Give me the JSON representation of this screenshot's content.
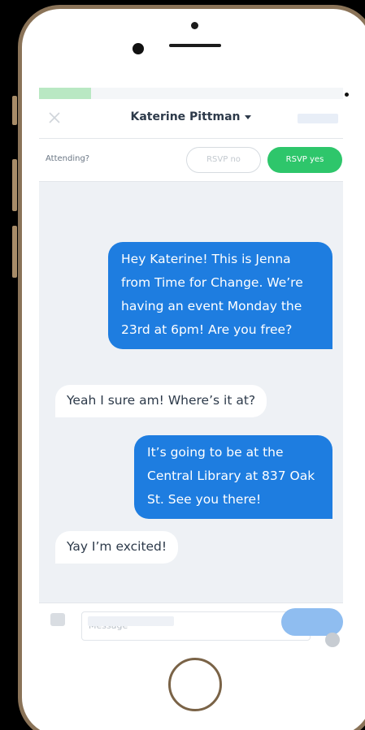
{
  "header": {
    "contact_name": "Katerine Pittman"
  },
  "progress": {
    "fraction": 0.17,
    "color": "#b9e8c3"
  },
  "rsvp": {
    "question": "Attending?",
    "no_label": "RSVP no",
    "yes_label": "RSVP yes",
    "yes_color": "#2ec66b"
  },
  "messages": [
    {
      "direction": "out",
      "text": "Hey Katerine! This is Jenna from Time for Change. We’re having an event Monday the 23rd at 6pm! Are you free?"
    },
    {
      "direction": "in",
      "text": "Yeah I sure am! Where’s it at?"
    },
    {
      "direction": "out",
      "text": "It’s going to be at the Central Library at 837 Oak St. See you there!"
    },
    {
      "direction": "in",
      "text": "Yay I’m excited!"
    }
  ],
  "compose": {
    "placeholder": "Message"
  },
  "colors": {
    "outgoing_bubble": "#1e7de0",
    "incoming_bubble": "#ffffff",
    "phone_frame": "#8a7358",
    "send_button": "#8fbdf0"
  },
  "icons": {
    "close": "close-icon",
    "dropdown": "chevron-down-icon",
    "chat": "chat-bubble-icon",
    "info": "info-icon"
  }
}
